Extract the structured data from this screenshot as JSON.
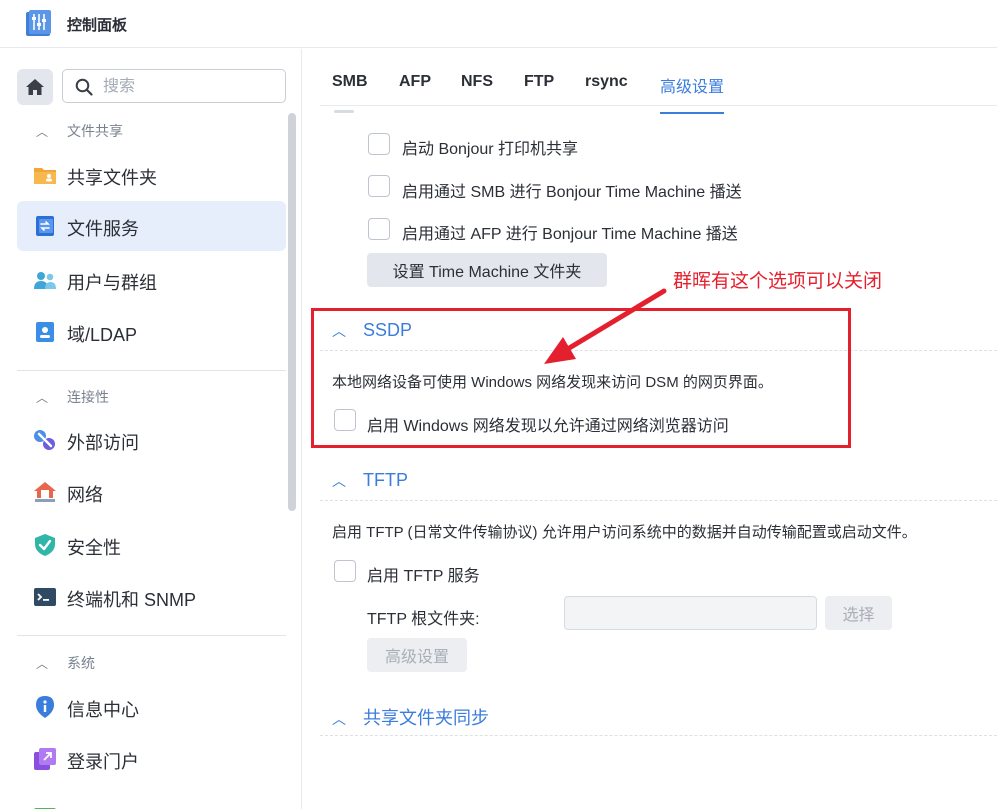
{
  "app": {
    "title": "控制面板"
  },
  "sidebar": {
    "search_placeholder": "搜索",
    "groups": [
      {
        "label": "文件共享",
        "items": [
          {
            "label": "共享文件夹"
          },
          {
            "label": "文件服务"
          },
          {
            "label": "用户与群组"
          },
          {
            "label": "域/LDAP"
          }
        ]
      },
      {
        "label": "连接性",
        "items": [
          {
            "label": "外部访问"
          },
          {
            "label": "网络"
          },
          {
            "label": "安全性"
          },
          {
            "label": "终端机和 SNMP"
          }
        ]
      },
      {
        "label": "系统",
        "items": [
          {
            "label": "信息中心"
          },
          {
            "label": "登录门户"
          }
        ]
      }
    ],
    "active_item": "文件服务"
  },
  "tabs": [
    {
      "label": "SMB"
    },
    {
      "label": "AFP"
    },
    {
      "label": "NFS"
    },
    {
      "label": "FTP"
    },
    {
      "label": "rsync"
    },
    {
      "label": "高级设置"
    }
  ],
  "active_tab": "高级设置",
  "bonjour": {
    "options": [
      {
        "label": "启动 Bonjour 打印机共享",
        "checked": false
      },
      {
        "label": "启用通过 SMB 进行 Bonjour Time Machine 播送",
        "checked": false
      },
      {
        "label": "启用通过 AFP 进行 Bonjour Time Machine 播送",
        "checked": false
      }
    ],
    "button_label": "设置 Time Machine 文件夹"
  },
  "ssdp": {
    "title": "SSDP",
    "description": "本地网络设备可使用 Windows 网络发现来访问 DSM 的网页界面。",
    "option_label": "启用 Windows 网络发现以允许通过网络浏览器访问",
    "checked": false
  },
  "tftp": {
    "title": "TFTP",
    "description": "启用 TFTP (日常文件传输协议) 允许用户访问系统中的数据并自动传输配置或启动文件。",
    "option_label": "启用 TFTP 服务",
    "checked": false,
    "root_folder_label": "TFTP 根文件夹:",
    "root_folder_value": "",
    "select_button": "选择",
    "advanced_button": "高级设置"
  },
  "shared_folder_sync": {
    "title": "共享文件夹同步"
  },
  "annotation": {
    "text": "群晖有这个选项可以关闭",
    "color": "#e5202e"
  },
  "colors": {
    "accent": "#3b7ddd",
    "annotation_red": "#e5202e",
    "active_nav_bg": "#e6eefb"
  }
}
